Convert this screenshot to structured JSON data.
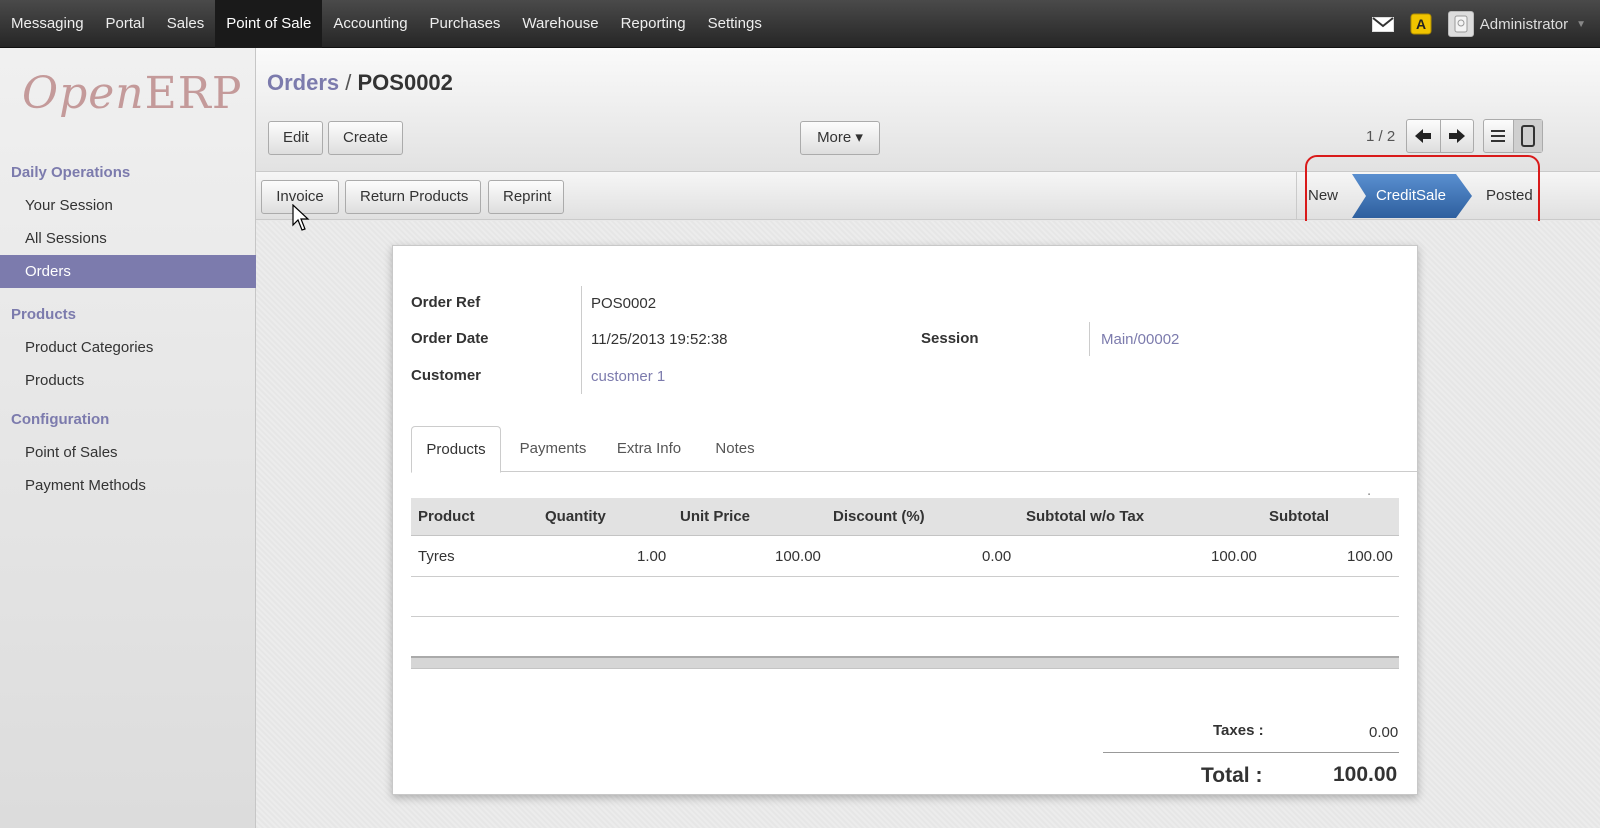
{
  "topbar": {
    "menu": [
      "Messaging",
      "Portal",
      "Sales",
      "Point of Sale",
      "Accounting",
      "Purchases",
      "Warehouse",
      "Reporting",
      "Settings"
    ],
    "active_menu": "Point of Sale",
    "user_name": "Administrator",
    "user_caret": "▼",
    "alert_glyph": "A"
  },
  "sidebar": {
    "logo": {
      "part1": "Open",
      "part2": "ERP"
    },
    "sections": [
      {
        "title": "Daily Operations",
        "items": [
          "Your Session",
          "All Sessions",
          "Orders"
        ]
      },
      {
        "title": "Products",
        "items": [
          "Product Categories",
          "Products"
        ]
      },
      {
        "title": "Configuration",
        "items": [
          "Point of Sales",
          "Payment Methods"
        ]
      }
    ],
    "active_item": "Orders"
  },
  "header": {
    "breadcrumb_parent": "Orders",
    "breadcrumb_sep": " / ",
    "breadcrumb_current": "POS0002",
    "edit_label": "Edit",
    "create_label": "Create",
    "more_label": "More ▾",
    "pager": "1 / 2"
  },
  "actions": {
    "invoice_label": "Invoice",
    "return_label": "Return Products",
    "reprint_label": "Reprint"
  },
  "statusbar": {
    "states": [
      "New",
      "CreditSale",
      "Posted"
    ],
    "current": "CreditSale",
    "highlight_color": "#d91a1a",
    "active_color": "#3d6fb0"
  },
  "form": {
    "order_ref_label": "Order Ref",
    "order_ref": "POS0002",
    "order_date_label": "Order Date",
    "order_date": "11/25/2013 19:52:38",
    "customer_label": "Customer",
    "customer": "customer 1",
    "session_label": "Session",
    "session": "Main/00002"
  },
  "tabs": [
    "Products",
    "Payments",
    "Extra Info",
    "Notes"
  ],
  "table": {
    "headers": [
      "Product",
      "Quantity",
      "Unit Price",
      "Discount (%)",
      "Subtotal w/o Tax",
      "Subtotal"
    ],
    "rows": [
      {
        "product": "Tyres",
        "quantity": "1.00",
        "unit_price": "100.00",
        "discount": "0.00",
        "subtotal_wo_tax": "100.00",
        "subtotal": "100.00"
      }
    ],
    "dot": "."
  },
  "totals": {
    "taxes_label": "Taxes :",
    "taxes": "0.00",
    "total_label": "Total :",
    "total": "100.00"
  },
  "colors": {
    "brand": "#7c7bad",
    "topbar": "#262626"
  }
}
